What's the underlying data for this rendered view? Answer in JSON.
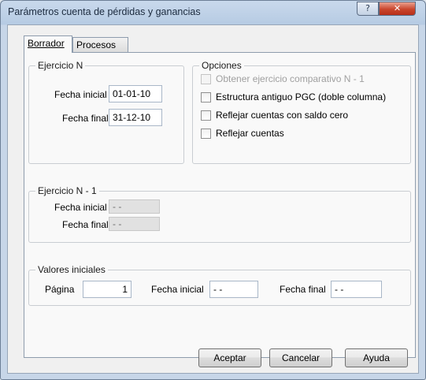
{
  "window": {
    "title": "Parámetros cuenta de pérdidas y ganancias",
    "help_button": "?",
    "close_button": "✕"
  },
  "tabs": [
    {
      "label": "Borrador",
      "active": true
    },
    {
      "label": "Procesos",
      "active": false
    }
  ],
  "ejercicio_n": {
    "legend": "Ejercicio N",
    "fecha_inicial_label": "Fecha inicial",
    "fecha_inicial_value": "01-01-10",
    "fecha_final_label": "Fecha final",
    "fecha_final_value": "31-12-10"
  },
  "opciones": {
    "legend": "Opciones",
    "items": [
      {
        "label": "Obtener ejercicio comparativo N - 1",
        "checked": false,
        "disabled": true
      },
      {
        "label": "Estructura antiguo PGC (doble columna)",
        "checked": false,
        "disabled": false
      },
      {
        "label": "Reflejar cuentas con saldo cero",
        "checked": false,
        "disabled": false
      },
      {
        "label": "Reflejar cuentas",
        "checked": false,
        "disabled": false
      }
    ]
  },
  "ejercicio_n1": {
    "legend": "Ejercicio N - 1",
    "fecha_inicial_label": "Fecha inicial",
    "fecha_inicial_value": " - -",
    "fecha_final_label": "Fecha final",
    "fecha_final_value": " - -"
  },
  "valores_iniciales": {
    "legend": "Valores iniciales",
    "pagina_label": "Página",
    "pagina_value": "1",
    "fecha_inicial_label": "Fecha inicial",
    "fecha_inicial_value": " - -",
    "fecha_final_label": "Fecha final",
    "fecha_final_value": " - -"
  },
  "buttons": {
    "accept": "Aceptar",
    "cancel": "Cancelar",
    "help": "Ayuda"
  }
}
